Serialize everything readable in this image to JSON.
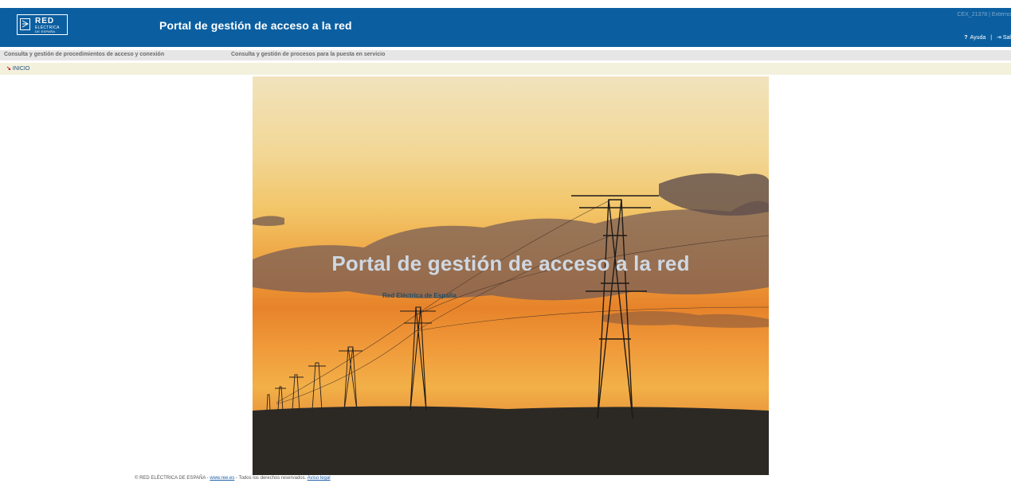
{
  "header": {
    "logo": {
      "line1": "RED",
      "line2": "ELÉCTRICA",
      "line3": "DE ESPAÑA"
    },
    "title": "Portal de gestión de acceso a la red",
    "user": "CEX_21378 | Externo",
    "help_label": "Ayuda",
    "separator": "|",
    "exit_label": "Sal"
  },
  "menu": {
    "items": [
      {
        "label": "Consulta y gestión de procedimientos de acceso y conexión"
      },
      {
        "label": "Consulta y gestión de procesos para la puesta en servicio"
      }
    ]
  },
  "breadcrumb": {
    "label": "INICIO"
  },
  "hero": {
    "title": "Portal de gestión de acceso a la red",
    "subtitle": "Red Eléctrica de España"
  },
  "footer": {
    "copyright": "© RED ELÉCTRICA DE ESPAÑA -",
    "site_link": "www.ree.es",
    "rights": "- Todos los derechos reservados.",
    "legal_link": "Aviso legal"
  },
  "colors": {
    "header_bg": "#0b5fa0",
    "menu_bg": "#e6e6e6",
    "breadcrumb_bg": "#f3f0dc"
  }
}
